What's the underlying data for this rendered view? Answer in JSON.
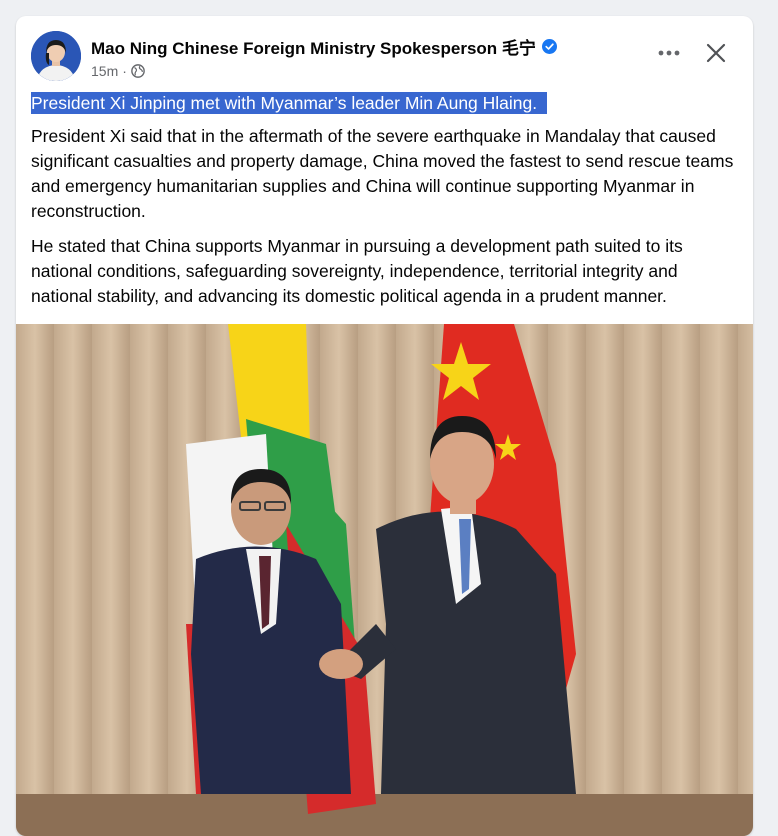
{
  "post": {
    "author": "Mao Ning Chinese Foreign Ministry Spokesperson 毛宁",
    "verified": true,
    "time": "15m",
    "separator": "·",
    "audience_icon": "globe-icon",
    "headline": "President Xi Jinping met with Myanmar’s leader Min Aung Hlaing.",
    "paragraph1": "President Xi said that in the aftermath of the severe earthquake in Mandalay that caused significant casualties and property damage, China moved the fastest to send rescue teams and emergency humanitarian supplies and China will continue supporting Myanmar in reconstruction.",
    "paragraph2": "He stated that China supports Myanmar in pursuing a development path suited to its national conditions, safeguarding sovereignty, independence, territorial integrity and national stability, and advancing its domestic political agenda in a prudent manner."
  },
  "controls": {
    "more_icon": "more-horizontal-icon",
    "close_icon": "close-icon"
  },
  "colors": {
    "selection": "#3867d0",
    "verified": "#1877f2",
    "meta_text": "#65676b",
    "page_bg": "#eef0f3"
  }
}
